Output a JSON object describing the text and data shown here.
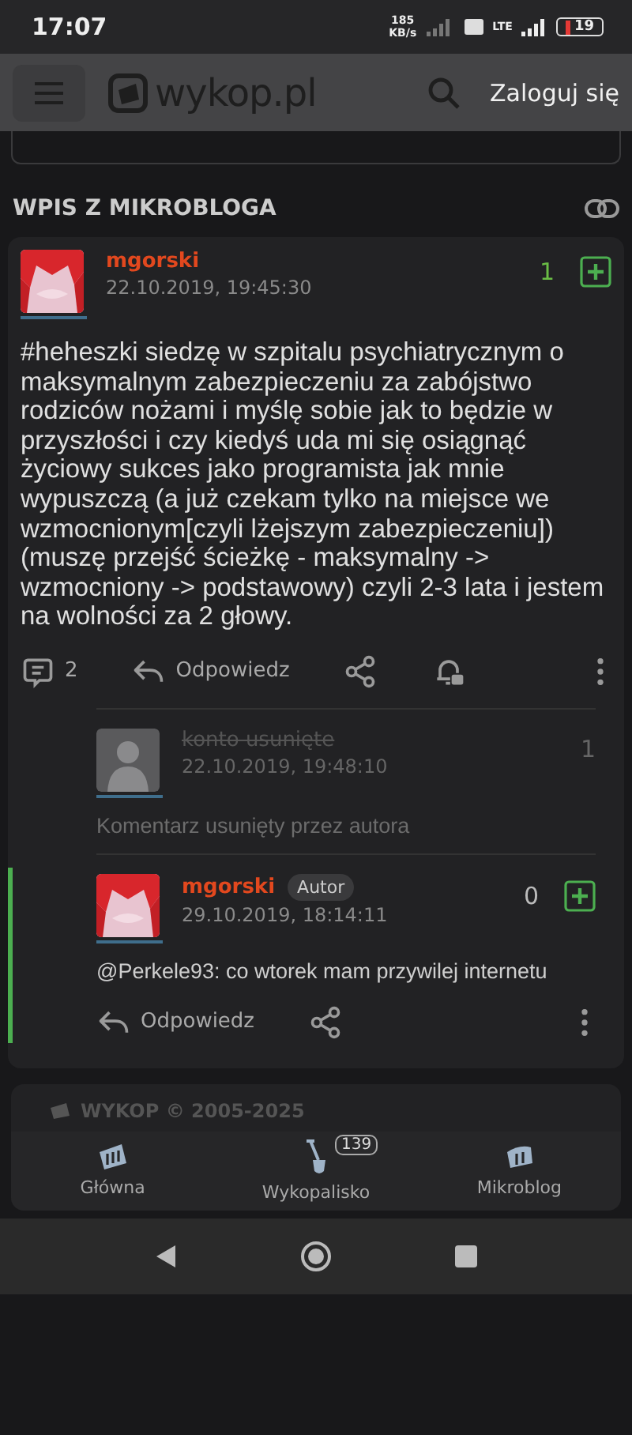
{
  "status_bar": {
    "time": "17:07",
    "speed_value": "185",
    "speed_unit": "KB/s",
    "network": "LTE",
    "battery": "19"
  },
  "header": {
    "logo_text": "wykop.pl",
    "login": "Zaloguj się"
  },
  "section": {
    "title": "WPIS Z MIKROBLOGA"
  },
  "post": {
    "author": "mgorski",
    "date": "22.10.2019, 19:45:30",
    "votes": "1",
    "body": "#heheszki siedzę w szpitalu psychiatrycznym o maksymalnym zabezpieczeniu za zabójstwo rodziców nożami i myślę sobie jak to będzie w przyszłości i czy kiedyś uda mi się osiągnąć życiowy sukces jako programista jak mnie wypuszczą (a już czekam tylko na miejsce we wzmocnionym[czyli lżejszym zabezpieczeniu]) (muszę przejść ścieżkę - maksymalny -> wzmocniony -> podstawowy) czyli 2-3 lata i jestem na wolności za 2 głowy.",
    "comments_count": "2",
    "reply": "Odpowiedz"
  },
  "comments": [
    {
      "kind": "deleted",
      "author": "konto usunięte",
      "date": "22.10.2019, 19:48:10",
      "votes": "1",
      "body": "Komentarz usunięty przez autora",
      "highlighted": false
    },
    {
      "kind": "normal",
      "author": "mgorski",
      "badge": "Autor",
      "date": "29.10.2019, 18:14:11",
      "votes": "0",
      "body": "@Perkele93: co wtorek mam przywilej internetu",
      "reply": "Odpowiedz",
      "highlighted": true
    }
  ],
  "footer": {
    "text": "WYKOP © 2005-2025"
  },
  "bottom_nav": [
    {
      "kind": "home",
      "label": "Główna"
    },
    {
      "kind": "dig",
      "label": "Wykopalisko",
      "badge": "139"
    },
    {
      "kind": "micro",
      "label": "Mikroblog"
    }
  ]
}
